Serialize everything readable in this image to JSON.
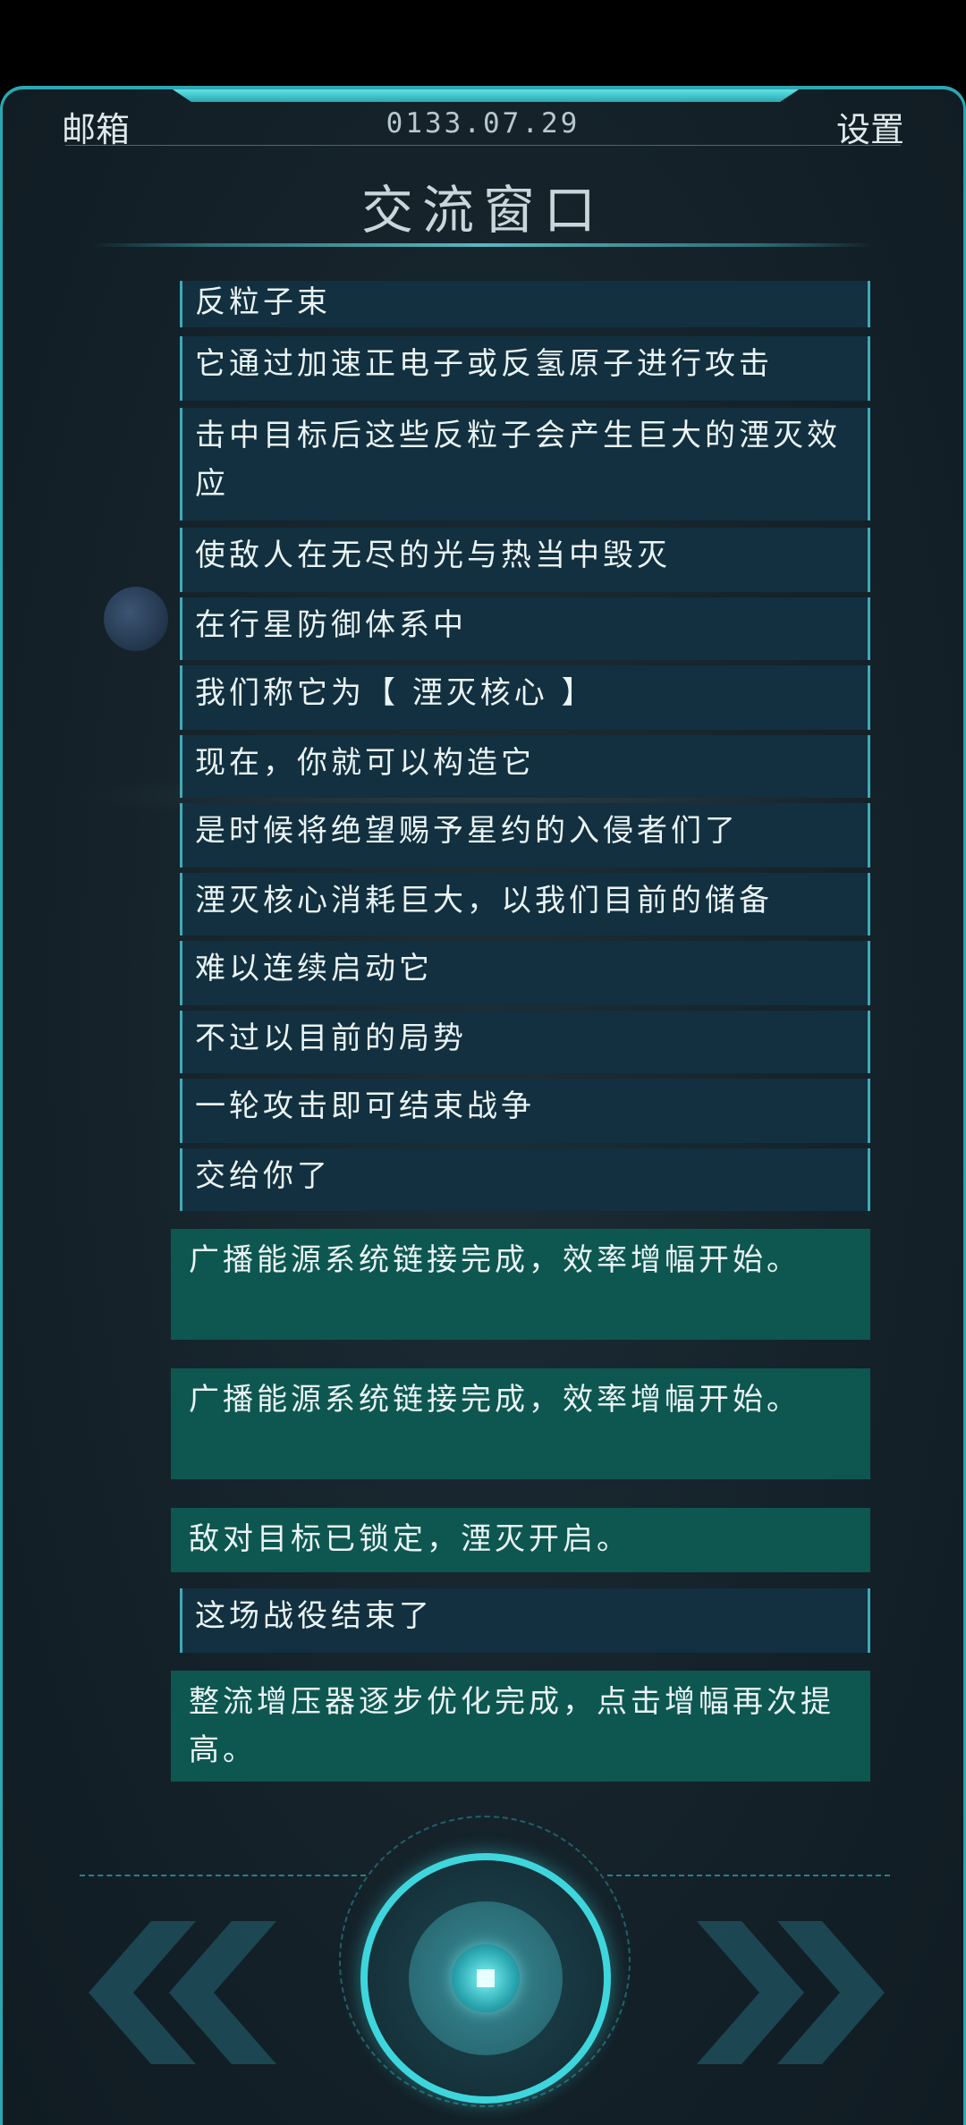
{
  "header": {
    "mailbox_label": "邮箱",
    "date": "0133.07.29",
    "settings_label": "设置",
    "title": "交流窗口"
  },
  "messages": [
    {
      "type": "system",
      "text": "反粒子束"
    },
    {
      "type": "system",
      "text": "它通过加速正电子或反氢原子进行攻击"
    },
    {
      "type": "system",
      "text": "击中目标后这些反粒子会产生巨大的湮灭效应"
    },
    {
      "type": "system",
      "text": "使敌人在无尽的光与热当中毁灭"
    },
    {
      "type": "system",
      "text": "在行星防御体系中"
    },
    {
      "type": "system",
      "text": "我们称它为【 湮灭核心 】"
    },
    {
      "type": "system",
      "text": "现在，你就可以构造它"
    },
    {
      "type": "system",
      "text": "是时候将绝望赐予星约的入侵者们了"
    },
    {
      "type": "system",
      "text": "湮灭核心消耗巨大，以我们目前的储备"
    },
    {
      "type": "system",
      "text": "难以连续启动它"
    },
    {
      "type": "system",
      "text": "不过以目前的局势"
    },
    {
      "type": "system",
      "text": "一轮攻击即可结束战争"
    },
    {
      "type": "system",
      "text": "交给你了"
    },
    {
      "type": "notice",
      "text": "广播能源系统链接完成，效率增幅开始。"
    },
    {
      "type": "notice",
      "text": "广播能源系统链接完成，效率增幅开始。"
    },
    {
      "type": "notice",
      "text": "敌对目标已锁定，湮灭开启。"
    },
    {
      "type": "system",
      "text": "这场战役结束了"
    },
    {
      "type": "notice",
      "text": "整流增压器逐步优化完成，点击增幅再次提高。"
    }
  ],
  "controls": {
    "prev_icon": "double-chevron-left-icon",
    "center_icon": "core-button-icon",
    "next_icon": "double-chevron-right-icon"
  },
  "colors": {
    "accent": "#3ed6dc",
    "system_bubble": "#12303f",
    "notice_bubble": "#0d5750",
    "frame_border": "#2aa8b3"
  }
}
